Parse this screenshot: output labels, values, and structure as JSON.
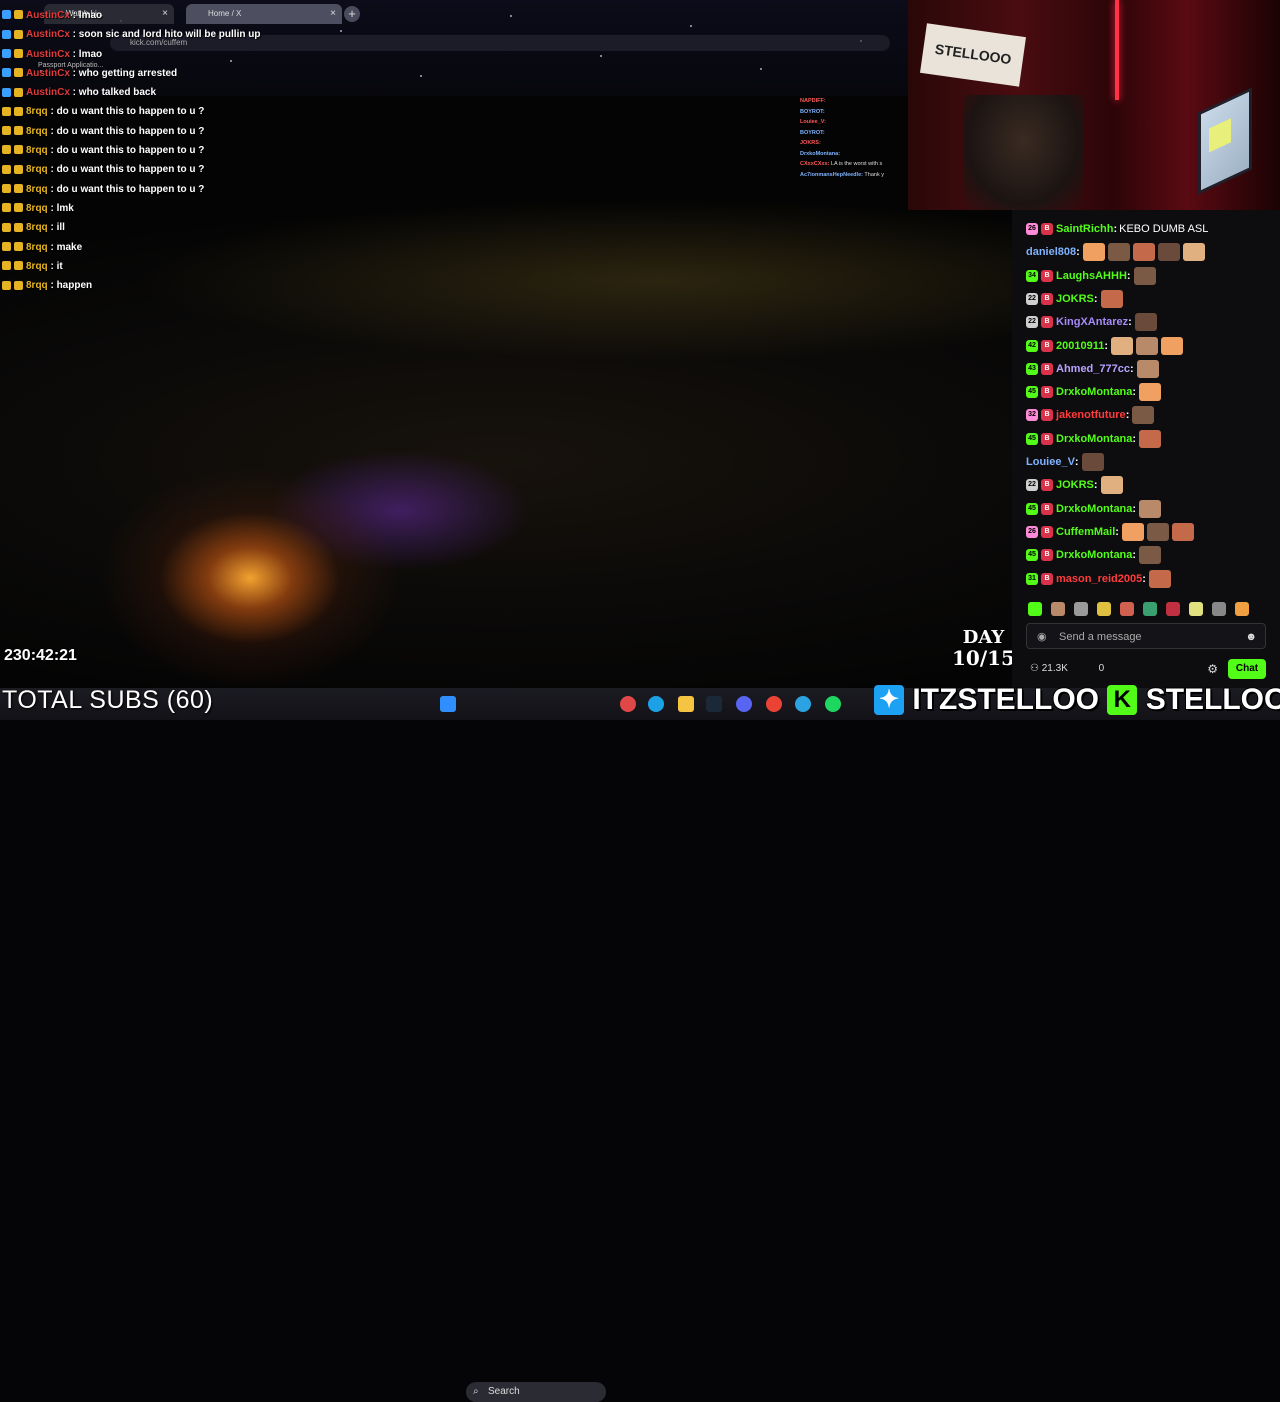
{
  "browser": {
    "tabs": [
      {
        "label": "Watch Li..."
      },
      {
        "label": "Home / X"
      }
    ],
    "address": "kick.com/cuffem",
    "bookmark": "Passport Applicatio..."
  },
  "overlay_chat": [
    {
      "user": "AustinCx",
      "message": "lmao",
      "color": "red"
    },
    {
      "user": "AustinCx",
      "message": "soon sic and lord hito will be pullin up",
      "color": "red"
    },
    {
      "user": "AustinCx",
      "message": "lmao",
      "color": "red"
    },
    {
      "user": "AustinCx",
      "message": "who getting arrested",
      "color": "red"
    },
    {
      "user": "AustinCx",
      "message": "who talked back",
      "color": "red"
    },
    {
      "user": "8rqq",
      "message": "do u want this to happen to u ?",
      "color": "gold"
    },
    {
      "user": "8rqq",
      "message": "do u want this to happen to u ?",
      "color": "gold"
    },
    {
      "user": "8rqq",
      "message": "do u want this to happen to u ?",
      "color": "gold"
    },
    {
      "user": "8rqq",
      "message": "do u want this to happen to u ?",
      "color": "gold"
    },
    {
      "user": "8rqq",
      "message": "do u want this to happen to u ?",
      "color": "gold"
    },
    {
      "user": "8rqq",
      "message": "lmk",
      "color": "gold"
    },
    {
      "user": "8rqq",
      "message": "ill",
      "color": "gold"
    },
    {
      "user": "8rqq",
      "message": "make",
      "color": "gold"
    },
    {
      "user": "8rqq",
      "message": "it",
      "color": "gold"
    },
    {
      "user": "8rqq",
      "message": "happen",
      "color": "gold"
    }
  ],
  "mini_chat": [
    {
      "user": "NAPDIFF:",
      "message": ""
    },
    {
      "user": "BOYROT:",
      "message": ""
    },
    {
      "user": "Louiee_V:",
      "message": ""
    },
    {
      "user": "BOYROT:",
      "message": ""
    },
    {
      "user": "JOKRS:",
      "message": ""
    },
    {
      "user": "DrxkoMontana:",
      "message": ""
    },
    {
      "user": "CXxxCXxx:",
      "message": "LA is the worst with s"
    },
    {
      "user": "Ac7ionmansHepNeedle:",
      "message": "Thank y"
    }
  ],
  "webcam": {
    "sign_text": "STELLOOO"
  },
  "stream_clock": "230:42:21",
  "day_counter": {
    "line1": "DAY",
    "line2": "10/15"
  },
  "kick_chat": [
    {
      "badge": "26",
      "badge_color": "#ff8ad8",
      "user": "SaintRichh",
      "name_color": "#53fc18",
      "message": "KEBO DUMB ASL",
      "emotes": 0
    },
    {
      "badge": "",
      "badge_color": "",
      "user": "daniel808",
      "name_color": "#7fb3ff",
      "message": "",
      "emotes": 5
    },
    {
      "badge": "34",
      "badge_color": "#53fc18",
      "user": "LaughsAHHH",
      "name_color": "#53fc18",
      "message": "",
      "emotes": 1
    },
    {
      "badge": "22",
      "badge_color": "#cfcfcf",
      "user": "JOKRS",
      "name_color": "#53fc18",
      "message": "",
      "emotes": 1
    },
    {
      "badge": "22",
      "badge_color": "#cfcfcf",
      "user": "KingXAntarez",
      "name_color": "#a78bfa",
      "message": "",
      "emotes": 1
    },
    {
      "badge": "42",
      "badge_color": "#53fc18",
      "user": "20010911",
      "name_color": "#53fc18",
      "message": "",
      "emotes": 3
    },
    {
      "badge": "43",
      "badge_color": "#53fc18",
      "user": "Ahmed_777cc",
      "name_color": "#b8a3ff",
      "message": "",
      "emotes": 1
    },
    {
      "badge": "45",
      "badge_color": "#53fc18",
      "user": "DrxkoMontana",
      "name_color": "#53fc18",
      "message": "",
      "emotes": 1
    },
    {
      "badge": "32",
      "badge_color": "#ff8ad8",
      "user": "jakenotfuture",
      "name_color": "#ff3b3b",
      "message": "",
      "emotes": 1
    },
    {
      "badge": "45",
      "badge_color": "#53fc18",
      "user": "DrxkoMontana",
      "name_color": "#53fc18",
      "message": "",
      "emotes": 1
    },
    {
      "badge": "",
      "badge_color": "",
      "user": "Louiee_V",
      "name_color": "#7fb3ff",
      "message": "",
      "emotes": 1
    },
    {
      "badge": "22",
      "badge_color": "#cfcfcf",
      "user": "JOKRS",
      "name_color": "#53fc18",
      "message": "",
      "emotes": 1
    },
    {
      "badge": "45",
      "badge_color": "#53fc18",
      "user": "DrxkoMontana",
      "name_color": "#53fc18",
      "message": "",
      "emotes": 1
    },
    {
      "badge": "26",
      "badge_color": "#ff8ad8",
      "user": "CuffemMail",
      "name_color": "#53fc18",
      "message": "",
      "emotes": 3
    },
    {
      "badge": "45",
      "badge_color": "#53fc18",
      "user": "DrxkoMontana",
      "name_color": "#53fc18",
      "message": "",
      "emotes": 1
    },
    {
      "badge": "31",
      "badge_color": "#53fc18",
      "user": "mason_reid2005",
      "name_color": "#ff3b3b",
      "message": "",
      "emotes": 1
    }
  ],
  "composer": {
    "placeholder": "Send a message",
    "viewers": "21.3K",
    "count": "0",
    "chat_button": "Chat"
  },
  "overlay_text": {
    "total_subs": "TOTAL SUBS (60)"
  },
  "taskbar": {
    "search_label": "Search"
  },
  "socials": {
    "twitter": "ITZSTELLOO",
    "kick": "STELLOOO"
  },
  "colors": {
    "kick_green": "#53fc18",
    "chat_red": "#e03a3a",
    "chat_gold": "#e6b422"
  }
}
